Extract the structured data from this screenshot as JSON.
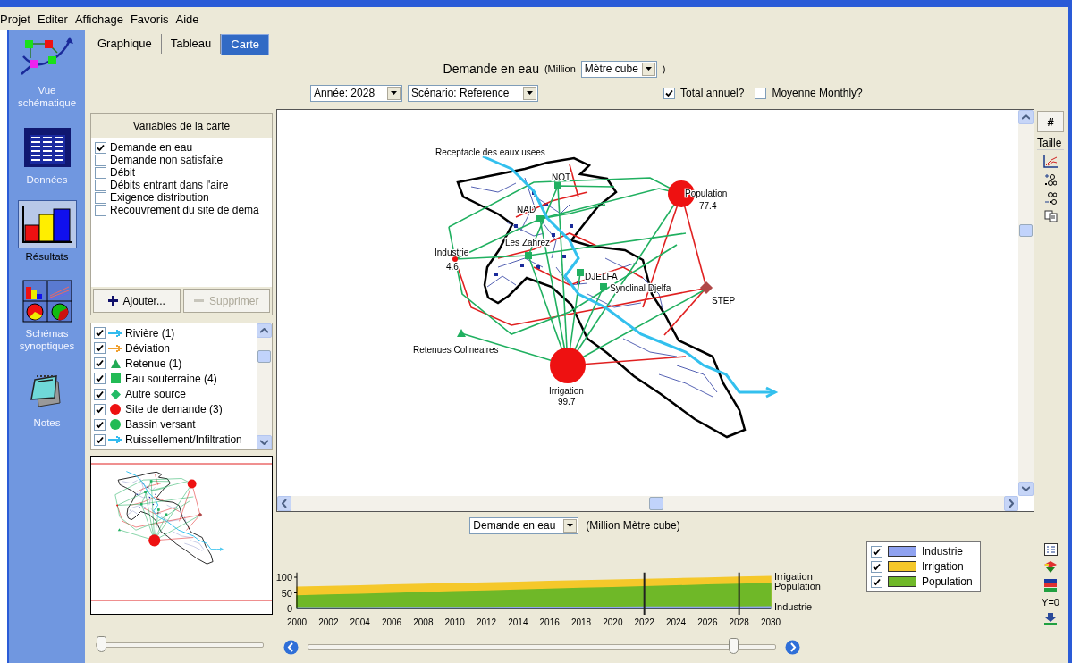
{
  "menu": [
    "Projet",
    "Editer",
    "Affichage",
    "Favoris",
    "Aide"
  ],
  "sidebar": {
    "items": [
      {
        "label": "Vue schématique",
        "kind": "schematic",
        "selected": false
      },
      {
        "label": "Données",
        "kind": "data",
        "selected": false
      },
      {
        "label": "Résultats",
        "kind": "results",
        "selected": true
      },
      {
        "label": "Schémas synoptiques",
        "kind": "synoptic",
        "selected": false
      },
      {
        "label": "Notes",
        "kind": "notes",
        "selected": false
      }
    ]
  },
  "tabs": [
    {
      "label": "Graphique",
      "selected": false
    },
    {
      "label": "Tableau",
      "selected": false
    },
    {
      "label": "Carte",
      "selected": true
    }
  ],
  "header": {
    "title": "Demande en eau",
    "unit_prefix": "(Million",
    "unit": "Mètre cube",
    "unit_suffix": ")",
    "year": "Année: 2028",
    "scenario": "Scénario: Reference",
    "options": [
      {
        "label": "Total annuel?",
        "checked": true
      },
      {
        "label": "Moyenne Monthly?",
        "checked": false
      }
    ]
  },
  "map_variables": {
    "title": "Variables de la carte",
    "items": [
      {
        "label": "Demande en eau",
        "checked": true
      },
      {
        "label": "Demande non satisfaite",
        "checked": false
      },
      {
        "label": "Débit",
        "checked": false
      },
      {
        "label": "Débits entrant dans l'aire",
        "checked": false
      },
      {
        "label": "Exigence distribution",
        "checked": false
      },
      {
        "label": "Recouvrement du site de dema",
        "checked": false
      }
    ],
    "buttons": [
      {
        "label": "Ajouter...",
        "kind": "add",
        "disabled": false
      },
      {
        "label": "Supprimer",
        "kind": "remove",
        "disabled": true
      }
    ]
  },
  "layers": {
    "items": [
      {
        "label": "Rivière (1)",
        "checked": true,
        "kind": "arrow",
        "color": "#33bbee"
      },
      {
        "label": "Déviation",
        "checked": true,
        "kind": "arrow",
        "color": "#f0a030"
      },
      {
        "label": "Retenue (1)",
        "checked": true,
        "kind": "triangle",
        "color": "#22aa55"
      },
      {
        "label": "Eau souterraine (4)",
        "checked": true,
        "kind": "square",
        "color": "#22bb55"
      },
      {
        "label": "Autre source",
        "checked": true,
        "kind": "diamond",
        "color": "#22bb66"
      },
      {
        "label": "Site de demande (3)",
        "checked": true,
        "kind": "circle",
        "color": "#ee1111"
      },
      {
        "label": "Bassin versant",
        "checked": true,
        "kind": "circle",
        "color": "#22bb55"
      },
      {
        "label": "Ruissellement/Infiltration",
        "checked": true,
        "kind": "arrow",
        "color": "#33bbef"
      }
    ]
  },
  "overview": {
    "slider": {
      "level": 0
    }
  },
  "map": {
    "nodes": [
      {
        "kind": "outflow",
        "label": "Receptacle des eaux usees"
      },
      {
        "kind": "groundwater",
        "label": "NOT"
      },
      {
        "kind": "groundwater",
        "label": "NAD"
      },
      {
        "kind": "demand",
        "label": "Population",
        "value": "77.4"
      },
      {
        "kind": "groundwater",
        "label": "Les Zahrez"
      },
      {
        "kind": "demand",
        "label": "Industrie",
        "value": "4.6"
      },
      {
        "kind": "groundwater",
        "label": "DJELFA"
      },
      {
        "kind": "groundwater",
        "label": "Synclinal Djelfa"
      },
      {
        "kind": "treatment",
        "label": "STEP"
      },
      {
        "kind": "reservoir",
        "label": "Retenues Colineaires"
      },
      {
        "kind": "demand",
        "label": "Irrigation",
        "value": "99.7"
      }
    ]
  },
  "map_tools": {
    "grid_button": "#",
    "size_label": "Taille"
  },
  "results_chart": {
    "variable": "Demande en eau",
    "unit": "(Million Mètre cube)",
    "chart_data": {
      "type": "area",
      "x": [
        2000,
        2002,
        2004,
        2006,
        2008,
        2010,
        2012,
        2014,
        2016,
        2018,
        2020,
        2022,
        2024,
        2026,
        2028,
        2030
      ],
      "xlim": [
        2000,
        2030
      ],
      "ylim": [
        0,
        115
      ],
      "xticks": [
        2000,
        2002,
        2004,
        2006,
        2008,
        2010,
        2012,
        2014,
        2016,
        2018,
        2020,
        2022,
        2024,
        2026,
        2028,
        2030
      ],
      "yticks": [
        0,
        50,
        100
      ],
      "series": [
        {
          "name": "Industrie",
          "color": "#8fa2f0",
          "values": [
            2.0,
            2.2,
            2.4,
            2.6,
            2.7,
            2.9,
            3.1,
            3.3,
            3.5,
            3.7,
            3.9,
            4.0,
            4.2,
            4.4,
            4.6,
            4.8
          ]
        },
        {
          "name": "Irrigation",
          "color": "#f5c82a",
          "values": [
            68.0,
            70.3,
            72.5,
            74.8,
            77.1,
            79.4,
            81.6,
            83.9,
            86.2,
            88.4,
            90.7,
            93.0,
            95.2,
            97.5,
            99.7,
            102.0
          ]
        },
        {
          "name": "Population",
          "color": "#6fb828",
          "values": [
            40.0,
            42.7,
            45.3,
            48.0,
            50.7,
            53.4,
            56.0,
            58.7,
            61.4,
            64.0,
            66.7,
            69.4,
            72.0,
            74.7,
            77.4,
            80.0
          ]
        }
      ],
      "ref_lines": [
        {
          "axis": "x",
          "value": 2022
        },
        {
          "axis": "x",
          "value": 2028
        }
      ]
    },
    "legend": [
      {
        "label": "Industrie",
        "checked": true,
        "color": "#8fa2f0"
      },
      {
        "label": "Irrigation",
        "checked": true,
        "color": "#f5c82a"
      },
      {
        "label": "Population",
        "checked": true,
        "color": "#6fb828"
      }
    ],
    "slider": {
      "level": 0.92
    },
    "tools": {
      "zero_button": "Y=0"
    }
  }
}
